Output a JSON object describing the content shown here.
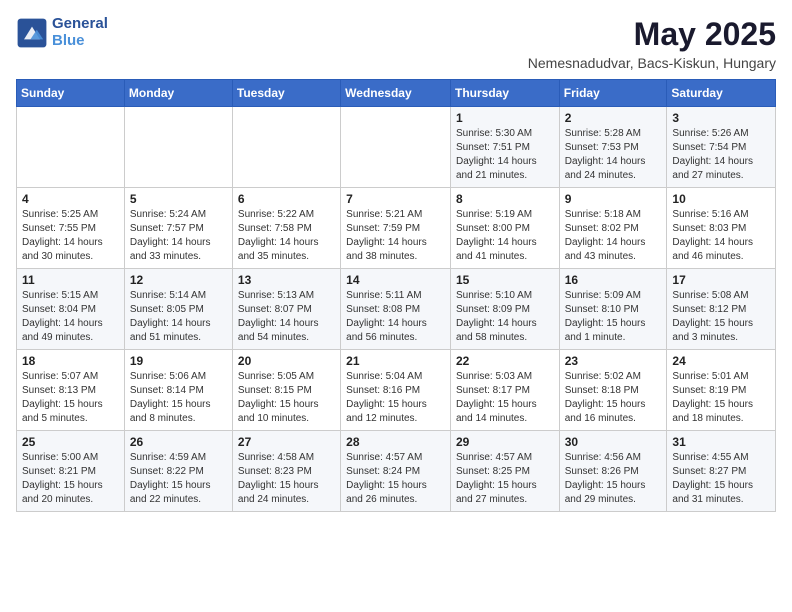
{
  "header": {
    "logo_general": "General",
    "logo_blue": "Blue",
    "month_year": "May 2025",
    "location": "Nemesnadudvar, Bacs-Kiskun, Hungary"
  },
  "weekdays": [
    "Sunday",
    "Monday",
    "Tuesday",
    "Wednesday",
    "Thursday",
    "Friday",
    "Saturday"
  ],
  "weeks": [
    [
      {
        "day": "",
        "info": ""
      },
      {
        "day": "",
        "info": ""
      },
      {
        "day": "",
        "info": ""
      },
      {
        "day": "",
        "info": ""
      },
      {
        "day": "1",
        "info": "Sunrise: 5:30 AM\nSunset: 7:51 PM\nDaylight: 14 hours\nand 21 minutes."
      },
      {
        "day": "2",
        "info": "Sunrise: 5:28 AM\nSunset: 7:53 PM\nDaylight: 14 hours\nand 24 minutes."
      },
      {
        "day": "3",
        "info": "Sunrise: 5:26 AM\nSunset: 7:54 PM\nDaylight: 14 hours\nand 27 minutes."
      }
    ],
    [
      {
        "day": "4",
        "info": "Sunrise: 5:25 AM\nSunset: 7:55 PM\nDaylight: 14 hours\nand 30 minutes."
      },
      {
        "day": "5",
        "info": "Sunrise: 5:24 AM\nSunset: 7:57 PM\nDaylight: 14 hours\nand 33 minutes."
      },
      {
        "day": "6",
        "info": "Sunrise: 5:22 AM\nSunset: 7:58 PM\nDaylight: 14 hours\nand 35 minutes."
      },
      {
        "day": "7",
        "info": "Sunrise: 5:21 AM\nSunset: 7:59 PM\nDaylight: 14 hours\nand 38 minutes."
      },
      {
        "day": "8",
        "info": "Sunrise: 5:19 AM\nSunset: 8:00 PM\nDaylight: 14 hours\nand 41 minutes."
      },
      {
        "day": "9",
        "info": "Sunrise: 5:18 AM\nSunset: 8:02 PM\nDaylight: 14 hours\nand 43 minutes."
      },
      {
        "day": "10",
        "info": "Sunrise: 5:16 AM\nSunset: 8:03 PM\nDaylight: 14 hours\nand 46 minutes."
      }
    ],
    [
      {
        "day": "11",
        "info": "Sunrise: 5:15 AM\nSunset: 8:04 PM\nDaylight: 14 hours\nand 49 minutes."
      },
      {
        "day": "12",
        "info": "Sunrise: 5:14 AM\nSunset: 8:05 PM\nDaylight: 14 hours\nand 51 minutes."
      },
      {
        "day": "13",
        "info": "Sunrise: 5:13 AM\nSunset: 8:07 PM\nDaylight: 14 hours\nand 54 minutes."
      },
      {
        "day": "14",
        "info": "Sunrise: 5:11 AM\nSunset: 8:08 PM\nDaylight: 14 hours\nand 56 minutes."
      },
      {
        "day": "15",
        "info": "Sunrise: 5:10 AM\nSunset: 8:09 PM\nDaylight: 14 hours\nand 58 minutes."
      },
      {
        "day": "16",
        "info": "Sunrise: 5:09 AM\nSunset: 8:10 PM\nDaylight: 15 hours\nand 1 minute."
      },
      {
        "day": "17",
        "info": "Sunrise: 5:08 AM\nSunset: 8:12 PM\nDaylight: 15 hours\nand 3 minutes."
      }
    ],
    [
      {
        "day": "18",
        "info": "Sunrise: 5:07 AM\nSunset: 8:13 PM\nDaylight: 15 hours\nand 5 minutes."
      },
      {
        "day": "19",
        "info": "Sunrise: 5:06 AM\nSunset: 8:14 PM\nDaylight: 15 hours\nand 8 minutes."
      },
      {
        "day": "20",
        "info": "Sunrise: 5:05 AM\nSunset: 8:15 PM\nDaylight: 15 hours\nand 10 minutes."
      },
      {
        "day": "21",
        "info": "Sunrise: 5:04 AM\nSunset: 8:16 PM\nDaylight: 15 hours\nand 12 minutes."
      },
      {
        "day": "22",
        "info": "Sunrise: 5:03 AM\nSunset: 8:17 PM\nDaylight: 15 hours\nand 14 minutes."
      },
      {
        "day": "23",
        "info": "Sunrise: 5:02 AM\nSunset: 8:18 PM\nDaylight: 15 hours\nand 16 minutes."
      },
      {
        "day": "24",
        "info": "Sunrise: 5:01 AM\nSunset: 8:19 PM\nDaylight: 15 hours\nand 18 minutes."
      }
    ],
    [
      {
        "day": "25",
        "info": "Sunrise: 5:00 AM\nSunset: 8:21 PM\nDaylight: 15 hours\nand 20 minutes."
      },
      {
        "day": "26",
        "info": "Sunrise: 4:59 AM\nSunset: 8:22 PM\nDaylight: 15 hours\nand 22 minutes."
      },
      {
        "day": "27",
        "info": "Sunrise: 4:58 AM\nSunset: 8:23 PM\nDaylight: 15 hours\nand 24 minutes."
      },
      {
        "day": "28",
        "info": "Sunrise: 4:57 AM\nSunset: 8:24 PM\nDaylight: 15 hours\nand 26 minutes."
      },
      {
        "day": "29",
        "info": "Sunrise: 4:57 AM\nSunset: 8:25 PM\nDaylight: 15 hours\nand 27 minutes."
      },
      {
        "day": "30",
        "info": "Sunrise: 4:56 AM\nSunset: 8:26 PM\nDaylight: 15 hours\nand 29 minutes."
      },
      {
        "day": "31",
        "info": "Sunrise: 4:55 AM\nSunset: 8:27 PM\nDaylight: 15 hours\nand 31 minutes."
      }
    ]
  ]
}
